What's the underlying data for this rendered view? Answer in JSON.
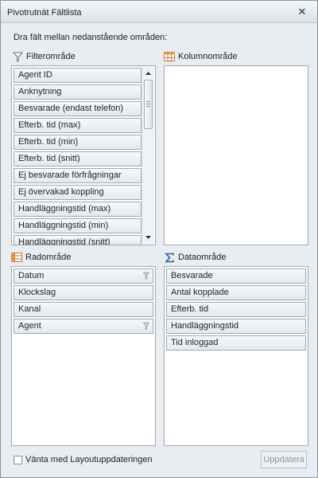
{
  "window": {
    "title": "Pivotrutnät Fältlista",
    "close_icon": "close-icon"
  },
  "instruction": "Dra fält mellan nedanstående områden:",
  "filter_area": {
    "label": "Filterområde",
    "icon": "funnel-icon",
    "fields": [
      "Agent ID",
      "Anknytning",
      "Besvarade (endast telefon)",
      "Efterb. tid (max)",
      "Efterb. tid (min)",
      "Efterb. tid (snitt)",
      "Ej besvarade förfrågningar",
      "Ej övervakad koppling",
      "Handläggningstid (max)",
      "Handläggningstid (min)",
      "Handläggningstid (snitt)"
    ]
  },
  "column_area": {
    "label": "Kolumnområde",
    "icon": "grid-icon",
    "fields": []
  },
  "row_area": {
    "label": "Radområde",
    "icon": "grid-icon",
    "fields": [
      {
        "label": "Datum",
        "filtered": true
      },
      {
        "label": "Klockslag",
        "filtered": false
      },
      {
        "label": "Kanal",
        "filtered": false
      },
      {
        "label": "Agent",
        "filtered": true
      }
    ]
  },
  "data_area": {
    "label": "Dataområde",
    "icon": "sigma-icon",
    "fields": [
      "Besvarade",
      "Antal kopplade",
      "Efterb. tid",
      "Handläggningstid",
      "Tid inloggad"
    ]
  },
  "footer": {
    "defer_label": "Vänta med Layoutuppdateringen",
    "defer_checked": false,
    "update_label": "Uppdatera",
    "update_enabled": false
  }
}
